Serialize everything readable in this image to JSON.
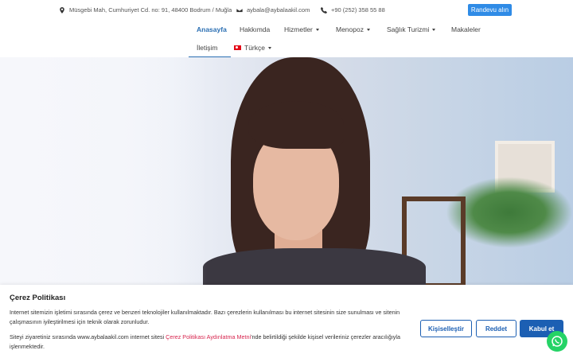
{
  "topbar": {
    "address": "Müsgebi Mah, Cumhuriyet Cd. no: 91, 48400 Bodrum / Muğla",
    "email": "aybala@aybalaakil.com",
    "phone": "+90 (252) 358 55 88",
    "appointment_label": "Randevu alın"
  },
  "nav": {
    "items": [
      {
        "label": "Anasayfa"
      },
      {
        "label": "Hakkımda"
      },
      {
        "label": "Hizmetler"
      },
      {
        "label": "Menopoz"
      },
      {
        "label": "Sağlık Turizmi"
      },
      {
        "label": "Makaleler"
      },
      {
        "label": "İletişim"
      },
      {
        "label": "Türkçe"
      }
    ]
  },
  "cookie": {
    "title": "Çerez Politikası",
    "line1": "Internet sitemizin işletimi sırasında çerez ve benzeri teknolojiler kullanılmaktadır. Bazı çerezlerin kullanılması bu internet sitesinin size sunulması ve sitenin",
    "line2": "çalışmasının iyileştirilmesi için teknik olarak zorunludur.",
    "line3_prefix": "Siteyi ziyaretiniz sırasında www.aybalaakil.com internet sitesi ",
    "link": "Çerez Politikası Aydınlatma Metni",
    "line3_suffix": "'nde belirtildiği şekilde kişisel verileriniz çerezler aracılığıyla",
    "line4": "işlenmektedir.",
    "buttons": {
      "customize": "Kişiselleştir",
      "reject": "Reddet",
      "accept": "Kabul et"
    }
  },
  "colors": {
    "accent": "#2f8be6",
    "nav_active": "#2b6fb3",
    "cookie_button": "#1c5fb3",
    "link": "#d7264f",
    "whatsapp": "#25d366"
  }
}
